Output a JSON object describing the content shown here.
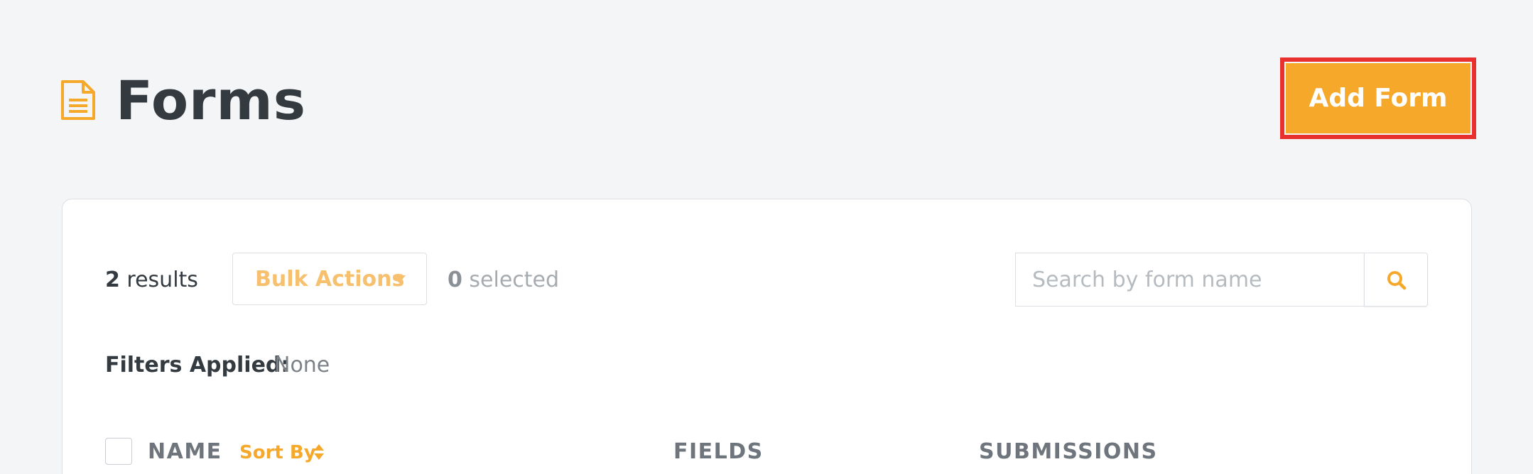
{
  "header": {
    "title": "Forms",
    "icon": "form-document-icon",
    "add_button_label": "Add Form"
  },
  "toolbar": {
    "results_count": "2",
    "results_label": "results",
    "bulk_actions_label": "Bulk Actions",
    "selected_count": "0",
    "selected_label": "selected",
    "search_placeholder": "Search by form name",
    "search_value": ""
  },
  "filters": {
    "label": "Filters Applied:",
    "value": "None"
  },
  "table": {
    "columns": {
      "name": "NAME",
      "sort_by": "Sort By",
      "fields": "FIELDS",
      "submissions": "SUBMISSIONS"
    }
  },
  "colors": {
    "accent": "#f6a82b",
    "highlight_outline": "#e8302e",
    "background": "#f4f5f7"
  }
}
